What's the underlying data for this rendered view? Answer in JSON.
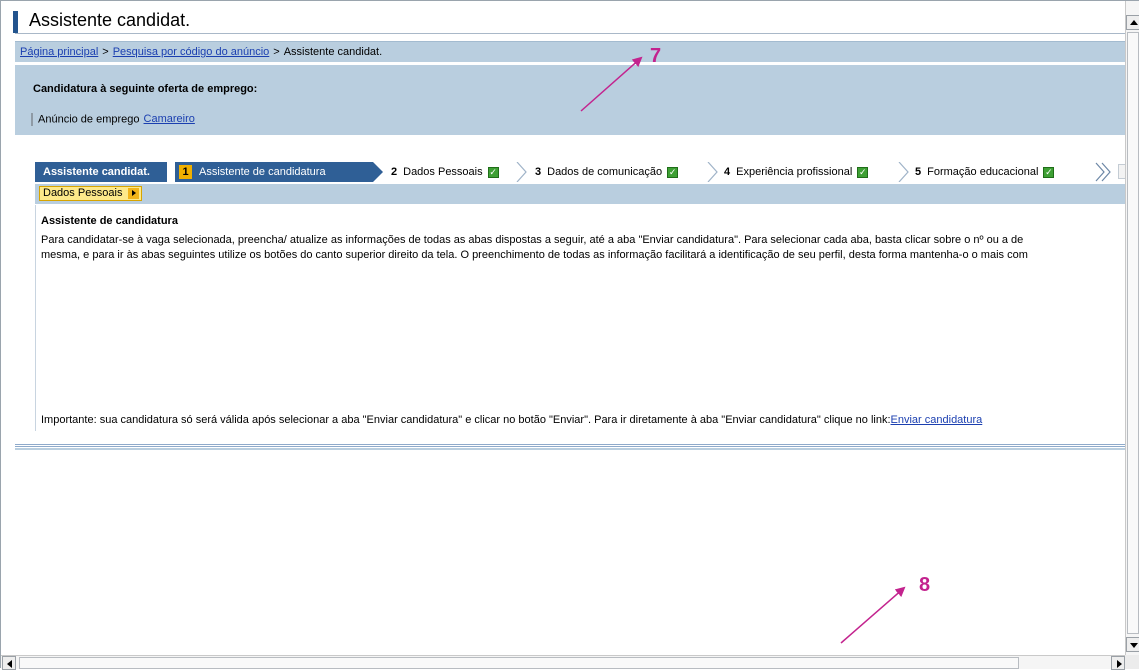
{
  "window": {
    "title": "Assistente candidat."
  },
  "breadcrumb": {
    "items": [
      "Página principal",
      "Pesquisa por código do anúncio",
      "Assistente candidat."
    ],
    "separator": ">"
  },
  "job_offer": {
    "heading": "Candidatura à seguinte oferta de emprego:",
    "ad_label": "Anúncio de emprego",
    "ad_link": "Camareiro"
  },
  "roadmap": {
    "title": "Assistente candidat.",
    "steps": [
      {
        "num": "1",
        "label": "Assistente de candidatura",
        "state": "active"
      },
      {
        "num": "2",
        "label": "Dados Pessoais",
        "state": "done"
      },
      {
        "num": "3",
        "label": "Dados de comunicação",
        "state": "done"
      },
      {
        "num": "4",
        "label": "Experiência profissional",
        "state": "done"
      },
      {
        "num": "5",
        "label": "Formação educacional",
        "state": "done"
      }
    ]
  },
  "subtab": {
    "label": "Dados Pessoais"
  },
  "panel": {
    "title": "Assistente de candidatura",
    "text_line1": "Para candidatar-se à vaga selecionada, preencha/ atualize as informações de todas as abas dispostas a seguir, até a aba \"Enviar candidatura\". Para selecionar cada aba, basta clicar sobre o nº ou a de",
    "text_line2": "mesma, e para ir às abas seguintes utilize os botões do canto superior direito da tela. O preenchimento de todas as informação facilitará a identificação de seu perfil, desta forma mantenha-o o mais com",
    "footer_text": "Importante: sua candidatura só será válida após selecionar a aba \"Enviar candidatura\" e clicar no botão \"Enviar\". Para ir diretamente à aba \"Enviar candidatura\" clique no link:",
    "footer_link": "Enviar candidatura"
  },
  "annotations": {
    "label_a": "7",
    "label_b": "8",
    "color": "#c3238e"
  },
  "colors": {
    "accent": "#2f5f96",
    "header_bg": "#b9cedf",
    "link": "#1b3fb0",
    "highlight": "#f0b000",
    "check": "#3ea034"
  }
}
